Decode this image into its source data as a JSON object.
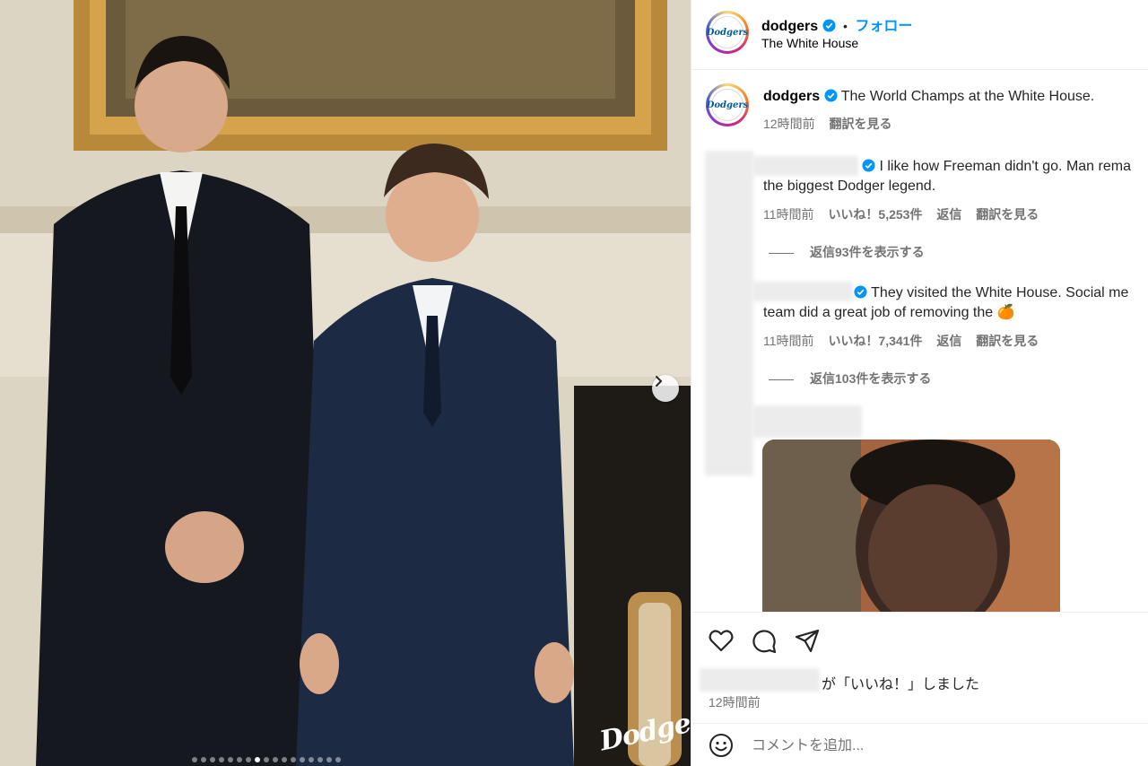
{
  "header": {
    "username": "dodgers",
    "separator": "•",
    "follow_label": "フォロー",
    "location": "The White House"
  },
  "caption": {
    "username": "dodgers",
    "text": "The World Champs at the White House.",
    "time": "12時間前",
    "translate": "翻訳を見る"
  },
  "comments": [
    {
      "line1": "I like how Freeman didn't go. Man rema",
      "line2": "the biggest Dodger legend.",
      "time": "11時間前",
      "likes": "いいね！5,253件",
      "reply": "返信",
      "translate": "翻訳を見る",
      "view_replies": "返信93件を表示する"
    },
    {
      "line1": "They visited the White House. Social me",
      "line2": "team did a great job of removing the 🍊",
      "time": "11時間前",
      "likes": "いいね！7,341件",
      "reply": "返信",
      "translate": "翻訳を見る",
      "view_replies": "返信103件を表示する"
    }
  ],
  "footer": {
    "liked_text": "が「いいね！」しました",
    "time": "12時間前",
    "comment_placeholder": "コメントを追加..."
  },
  "photo": {
    "watermark": "Dodgers",
    "slide_count": 17,
    "active_slide": 8
  },
  "avatar_logo_text": "Dodgers",
  "colors": {
    "link": "#0095f6",
    "muted": "#737373",
    "verified": "#0095f6"
  },
  "icons": [
    "heart-icon",
    "comment-icon",
    "share-icon",
    "emoji-icon",
    "verified-badge-icon",
    "chevron-right-icon"
  ]
}
